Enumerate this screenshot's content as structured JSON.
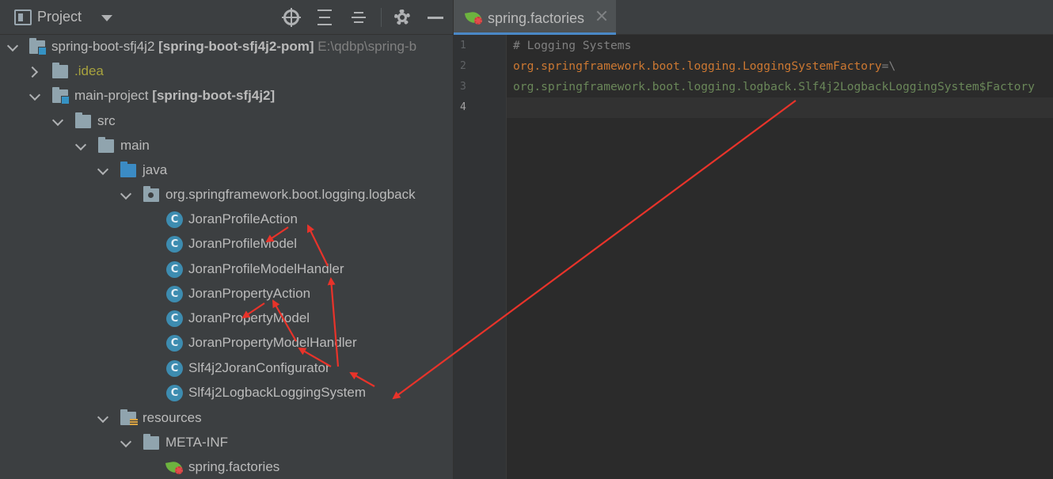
{
  "project_panel": {
    "title": "Project",
    "toolbar_icons": [
      "locate-icon",
      "expand-all-icon",
      "collapse-all-icon",
      "gear-icon",
      "minimize-icon"
    ],
    "tree": {
      "root": {
        "name": "spring-boot-sfj4j2",
        "module": "[spring-boot-sfj4j2-pom]",
        "path": "E:\\qdbp\\spring-b"
      },
      "idea": ".idea",
      "main_project": {
        "name": "main-project",
        "module": "[spring-boot-sfj4j2]"
      },
      "src": "src",
      "main": "main",
      "java": "java",
      "package": "org.springframework.boot.logging.logback",
      "classes": [
        "JoranProfileAction",
        "JoranProfileModel",
        "JoranProfileModelHandler",
        "JoranPropertyAction",
        "JoranPropertyModel",
        "JoranPropertyModelHandler",
        "Slf4j2JoranConfigurator",
        "Slf4j2LogbackLoggingSystem"
      ],
      "resources": "resources",
      "meta_inf": "META-INF",
      "spring_factories": "spring.factories"
    }
  },
  "editor": {
    "tab": {
      "label": "spring.factories"
    },
    "line_numbers": [
      "1",
      "2",
      "3",
      "4"
    ],
    "lines": {
      "l1": "# Logging Systems",
      "l2_key": "org.springframework.boot.logging.LoggingSystemFactory",
      "l2_op": "=\\",
      "l3": "org.springframework.boot.logging.logback.Slf4j2LogbackLoggingSystem$Factory",
      "l4": ""
    }
  },
  "colors": {
    "annotation_arrow": "#e8332a",
    "panel_bg": "#3c3f41",
    "editor_bg": "#2b2b2b",
    "class_icon": "#3d8cb0"
  }
}
